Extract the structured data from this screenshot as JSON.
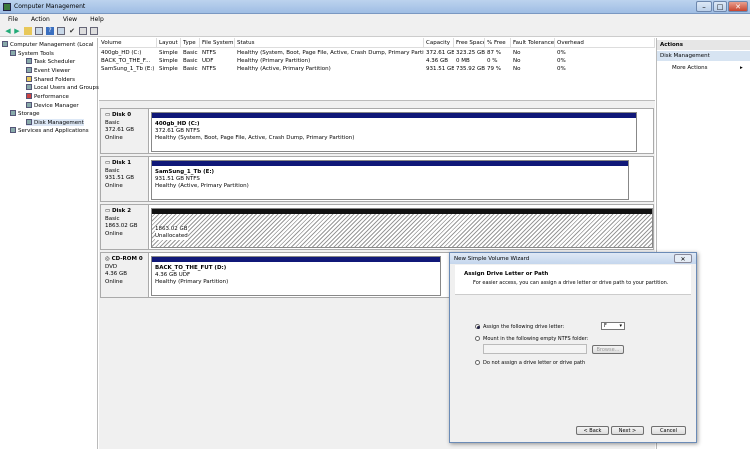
{
  "window": {
    "title": "Computer Management"
  },
  "menu": [
    "File",
    "Action",
    "View",
    "Help"
  ],
  "tree": [
    {
      "label": "Computer Management (Local",
      "indent": 0
    },
    {
      "label": "System Tools",
      "indent": 1
    },
    {
      "label": "Task Scheduler",
      "indent": 2
    },
    {
      "label": "Event Viewer",
      "indent": 2
    },
    {
      "label": "Shared Folders",
      "indent": 2
    },
    {
      "label": "Local Users and Groups",
      "indent": 2
    },
    {
      "label": "Performance",
      "indent": 2
    },
    {
      "label": "Device Manager",
      "indent": 2
    },
    {
      "label": "Storage",
      "indent": 1
    },
    {
      "label": "Disk Management",
      "indent": 2
    },
    {
      "label": "Services and Applications",
      "indent": 1
    }
  ],
  "volume_columns": [
    "Volume",
    "Layout",
    "Type",
    "File System",
    "Status",
    "Capacity",
    "Free Space",
    "% Free",
    "Fault Tolerance",
    "Overhead"
  ],
  "volumes": [
    [
      "400gb_HD (C:)",
      "Simple",
      "Basic",
      "NTFS",
      "Healthy (System, Boot, Page File, Active, Crash Dump, Primary Partition)",
      "372.61 GB",
      "323.25 GB",
      "87 %",
      "No",
      "0%"
    ],
    [
      "BACK_TO_THE_F...",
      "Simple",
      "Basic",
      "UDF",
      "Healthy (Primary Partition)",
      "4.36 GB",
      "0 MB",
      "0 %",
      "No",
      "0%"
    ],
    [
      "SamSung_1_Tb (E:)",
      "Simple",
      "Basic",
      "NTFS",
      "Healthy (Active, Primary Partition)",
      "931.51 GB",
      "735.92 GB",
      "79 %",
      "No",
      "0%"
    ]
  ],
  "disks": [
    {
      "name": "Disk 0",
      "type": "Basic",
      "size": "372.61 GB",
      "status": "Online",
      "part_title": "400gb_HD  (C:)",
      "part_size": "372.61 GB NTFS",
      "part_status": "Healthy (System, Boot, Page File, Active, Crash Dump, Primary Partition)"
    },
    {
      "name": "Disk 1",
      "type": "Basic",
      "size": "931.51 GB",
      "status": "Online",
      "part_title": "SamSung_1_Tb  (E:)",
      "part_size": "931.51 GB NTFS",
      "part_status": "Healthy (Active, Primary Partition)"
    },
    {
      "name": "Disk 2",
      "type": "Basic",
      "size": "1863.02 GB",
      "status": "Online",
      "part_title": "",
      "part_size": "1863.02 GB",
      "part_status": "Unallocated"
    },
    {
      "name": "CD-ROM 0",
      "type": "DVD",
      "size": "4.36 GB",
      "status": "Online",
      "part_title": "BACK_TO_THE_FUT  (D:)",
      "part_size": "4.36 GB UDF",
      "part_status": "Healthy (Primary Partition)"
    }
  ],
  "actions": {
    "header": "Actions",
    "section": "Disk Management",
    "item": "More Actions"
  },
  "wizard": {
    "title": "New Simple Volume Wizard",
    "heading": "Assign Drive Letter or Path",
    "subtext": "For easier access, you can assign a drive letter or drive path to your partition.",
    "opt1": "Assign the following drive letter:",
    "drive_letter": "F",
    "opt2": "Mount in the following empty NTFS folder:",
    "browse": "Browse...",
    "opt3": "Do not assign a drive letter or drive path",
    "back": "< Back",
    "next": "Next >",
    "cancel": "Cancel"
  }
}
